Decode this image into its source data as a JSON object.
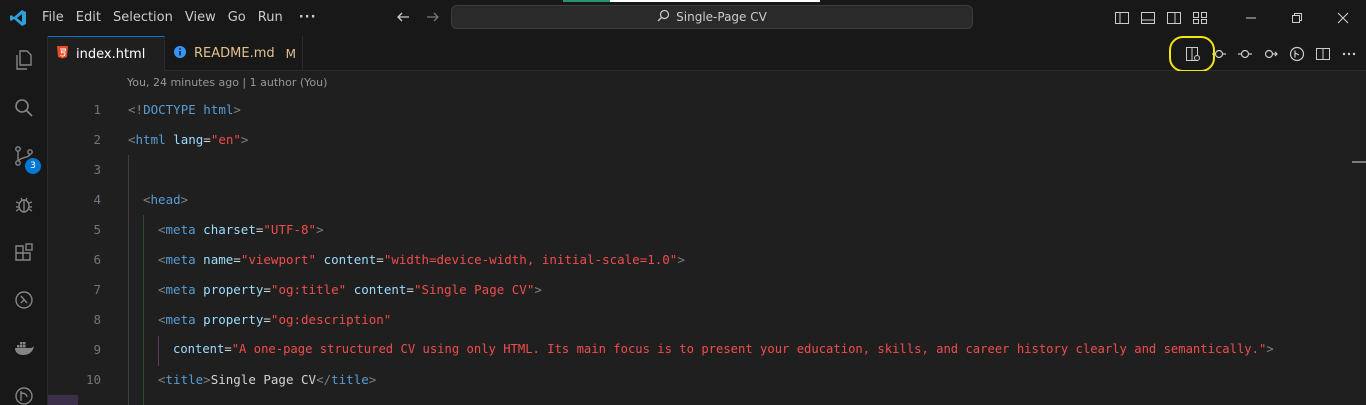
{
  "menu": [
    "File",
    "Edit",
    "Selection",
    "View",
    "Go",
    "Run",
    "···"
  ],
  "command_center": {
    "label": "Single-Page CV",
    "icon": "search-icon"
  },
  "tabs": [
    {
      "label": "index.html",
      "icon": "html5-icon",
      "active": true
    },
    {
      "label": "README.md",
      "icon": "info-icon",
      "modified": "M",
      "active": false
    }
  ],
  "activity_bar": {
    "items": [
      "explorer-icon",
      "search-icon",
      "source-control-icon",
      "run-debug-icon",
      "extensions-icon",
      "remote-explorer-icon",
      "docker-icon",
      "github-icon"
    ],
    "source_control_badge": "3"
  },
  "editor": {
    "blame": "You, 24 minutes ago | 1 author (You)",
    "lines": [
      {
        "n": "1"
      },
      {
        "n": "2"
      },
      {
        "n": "3"
      },
      {
        "n": "4"
      },
      {
        "n": "5"
      },
      {
        "n": "6"
      },
      {
        "n": "7"
      },
      {
        "n": "8"
      },
      {
        "n": "9"
      },
      {
        "n": "10"
      }
    ],
    "tokens": {
      "l1_doctype": "DOCTYPE html",
      "l2_tag": "html",
      "l2_attr": "lang",
      "l2_val": "\"en\"",
      "l4_tag": "head",
      "l5_tag": "meta",
      "l5_attr": "charset",
      "l5_val": "\"UTF-8\"",
      "l6_tag": "meta",
      "l6_attr1": "name",
      "l6_val1": "\"viewport\"",
      "l6_attr2": "content",
      "l6_val2": "\"width=device-width, initial-scale=1.0\"",
      "l7_tag": "meta",
      "l7_attr1": "property",
      "l7_val1": "\"og:title\"",
      "l7_attr2": "content",
      "l7_val2": "\"Single Page CV\"",
      "l8_tag": "meta",
      "l8_attr1": "property",
      "l8_val1": "\"og:description\"",
      "l9_attr": "content",
      "l9_val": "\"A one-page structured CV using only HTML. Its main focus is to present your education, skills, and career history clearly and semantically.\"",
      "l10_tag": "title",
      "l10_text": "Single Page CV",
      "l10_close": "title"
    }
  },
  "colors": {
    "accent": "#0078d4",
    "highlight": "#f2e60a",
    "tag": "#569cd6",
    "string": "#ce9178"
  }
}
